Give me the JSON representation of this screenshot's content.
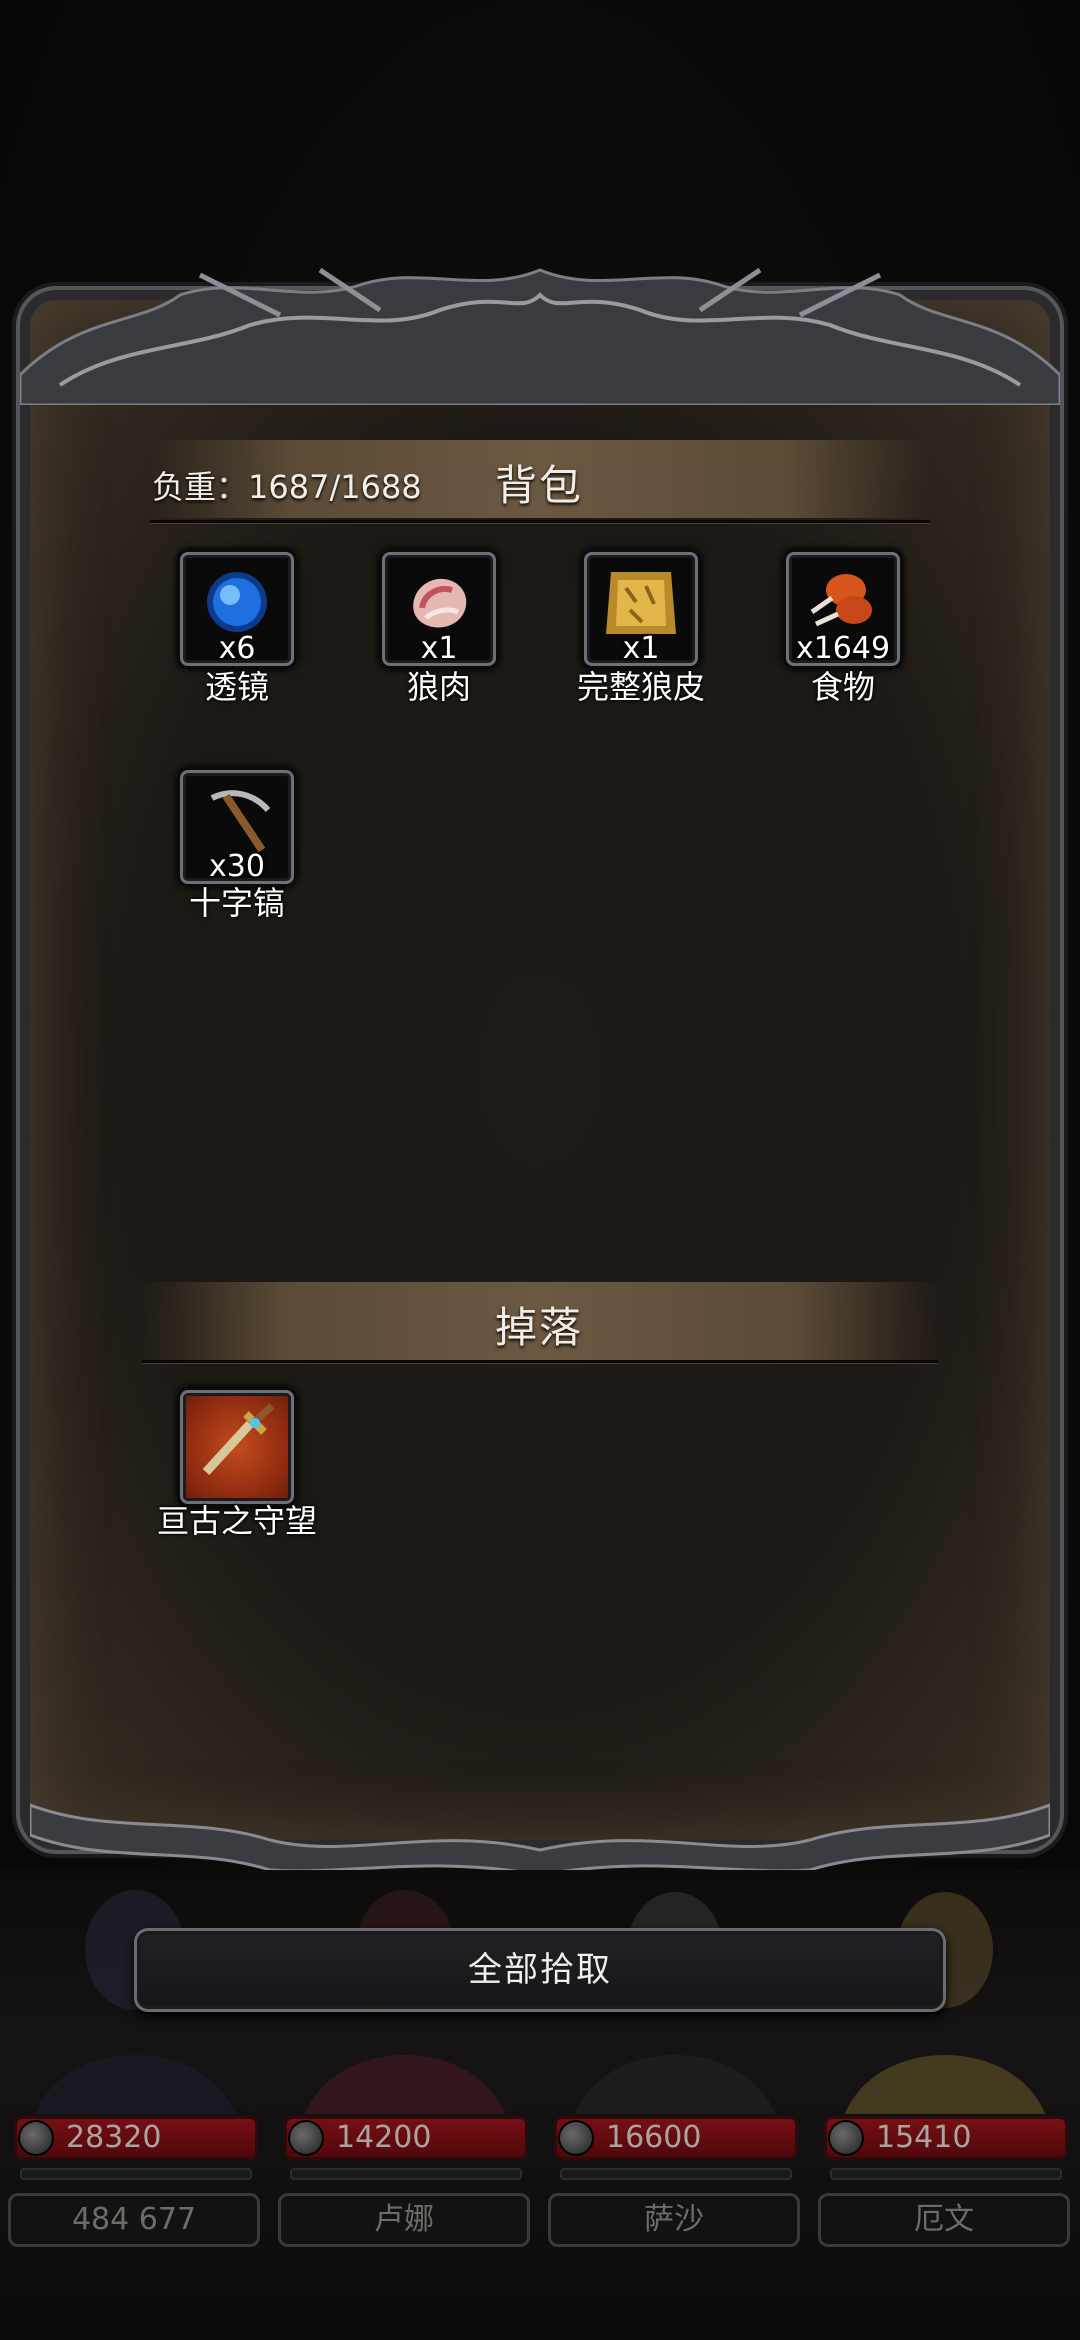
{
  "inventory": {
    "weight_label": "负重：1687/1688",
    "bag_title": "背包",
    "drop_title": "掉落",
    "bag_items": [
      {
        "name": "透镜",
        "count": "x6",
        "icon": "blue-orb-icon"
      },
      {
        "name": "狼肉",
        "count": "x1",
        "icon": "meat-icon"
      },
      {
        "name": "完整狼皮",
        "count": "x1",
        "icon": "fur-pelt-icon"
      },
      {
        "name": "食物",
        "count": "x1649",
        "icon": "drumstick-icon"
      },
      {
        "name": "十字镐",
        "count": "x30",
        "icon": "pickaxe-icon"
      }
    ],
    "drop_items": [
      {
        "name": "亘古之守望",
        "icon": "dagger-icon",
        "rarity_color": "#c44c1c"
      }
    ]
  },
  "actions": {
    "pickup_all_label": "全部拾取"
  },
  "party": [
    {
      "hp": "28320",
      "name": "484 677"
    },
    {
      "hp": "14200",
      "name": "卢娜"
    },
    {
      "hp": "16600",
      "name": "萨沙"
    },
    {
      "hp": "15410",
      "name": "厄文"
    }
  ],
  "colors": {
    "panel": "#1c1814",
    "header_band": "#6b5841",
    "hp_bar": "#7a1014"
  }
}
